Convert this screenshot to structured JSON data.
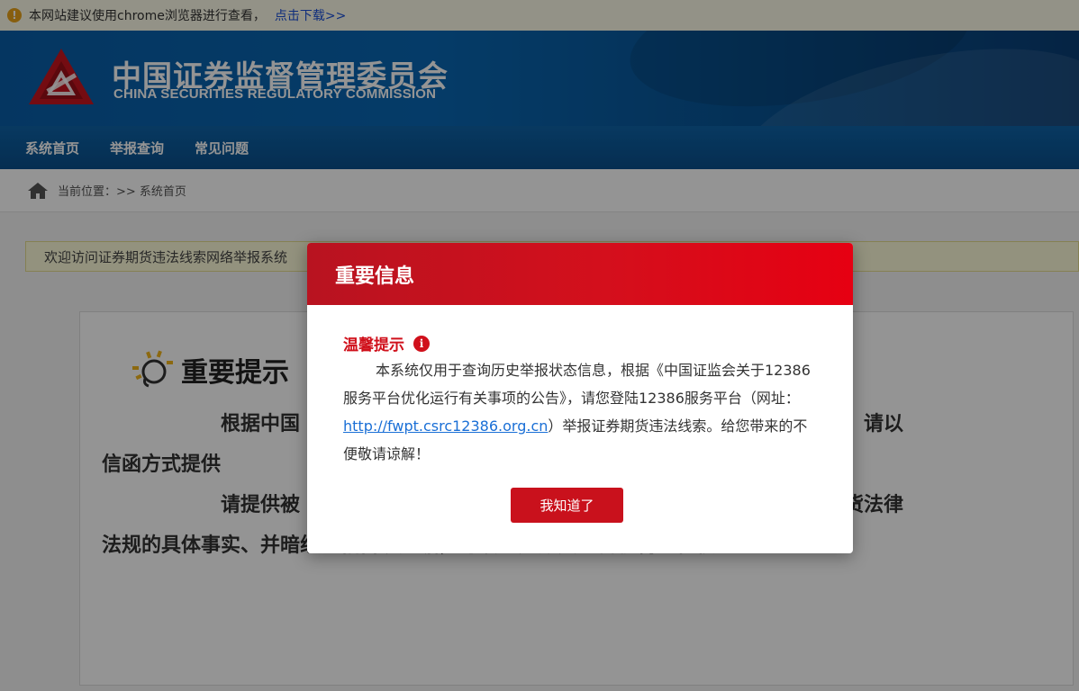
{
  "notice_bar": {
    "text": "本网站建议使用chrome浏览器进行查看，",
    "link": "点击下载>>"
  },
  "header": {
    "org_name_cn": "中国证券监督管理委员会",
    "org_name_en": "CHINA SECURITIES REGULATORY COMMISSION"
  },
  "nav": {
    "items": [
      "系统首页",
      "举报查询",
      "常见问题"
    ]
  },
  "breadcrumb": {
    "label": "当前位置：>> 系统首页"
  },
  "welcome": {
    "text": "欢迎访问证券期货违法线索网络举报系统"
  },
  "card": {
    "title": "重要提示",
    "line1": "根据中国",
    "line1_end": "举报，请以",
    "line2": "信函方式提供",
    "line3": "请提供被",
    "line3_end": "券期货法律",
    "line4": "法规的具体事实、并暗线索相首现速据，可以证分期货监督机构进行核查。"
  },
  "modal": {
    "title": "重要信息",
    "warm_tip": "温馨提示",
    "body_part1": "本系统仅用于查询历史举报状态信息，根据《中国证监会关于12386服务平台优化运行有关事项的公告》，请您登陆12386服务平台（网址：",
    "link_text": "http://fwpt.csrc12386.org.cn",
    "body_part2": "）举报证券期货违法线索。给您带来的不便敬请谅解！",
    "confirm_button": "我知道了"
  },
  "colors": {
    "header_blue": "#0a5ea8",
    "modal_red": "#d40f1c",
    "link_blue": "#1a6fd6"
  }
}
